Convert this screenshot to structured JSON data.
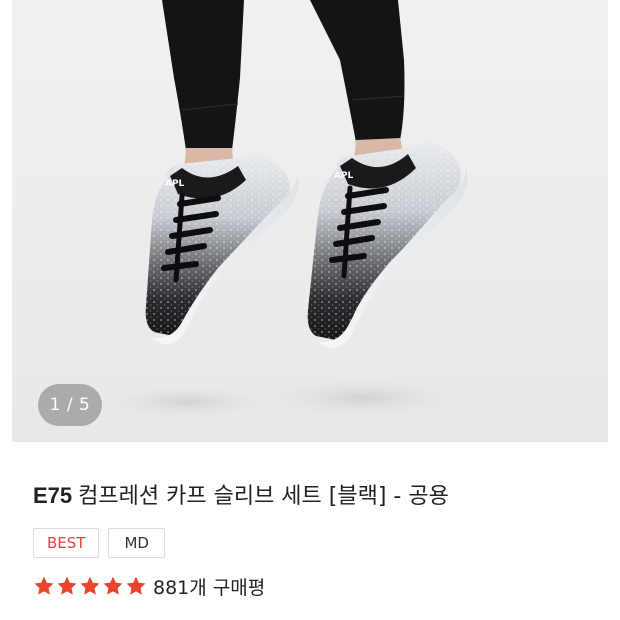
{
  "gallery": {
    "counter_text": "1 / 5",
    "current_index": 1,
    "total_images": 5
  },
  "product": {
    "model": "E75",
    "name": "컴프레션 카프 슬리브 세트 [블랙] - 공용",
    "badges": [
      {
        "label": "BEST",
        "color": "#e0443e"
      },
      {
        "label": "MD",
        "color": "#333333"
      }
    ]
  },
  "rating": {
    "stars": 5,
    "max_stars": 5,
    "star_color": "#e8452a",
    "review_text": "881개 구매평"
  }
}
